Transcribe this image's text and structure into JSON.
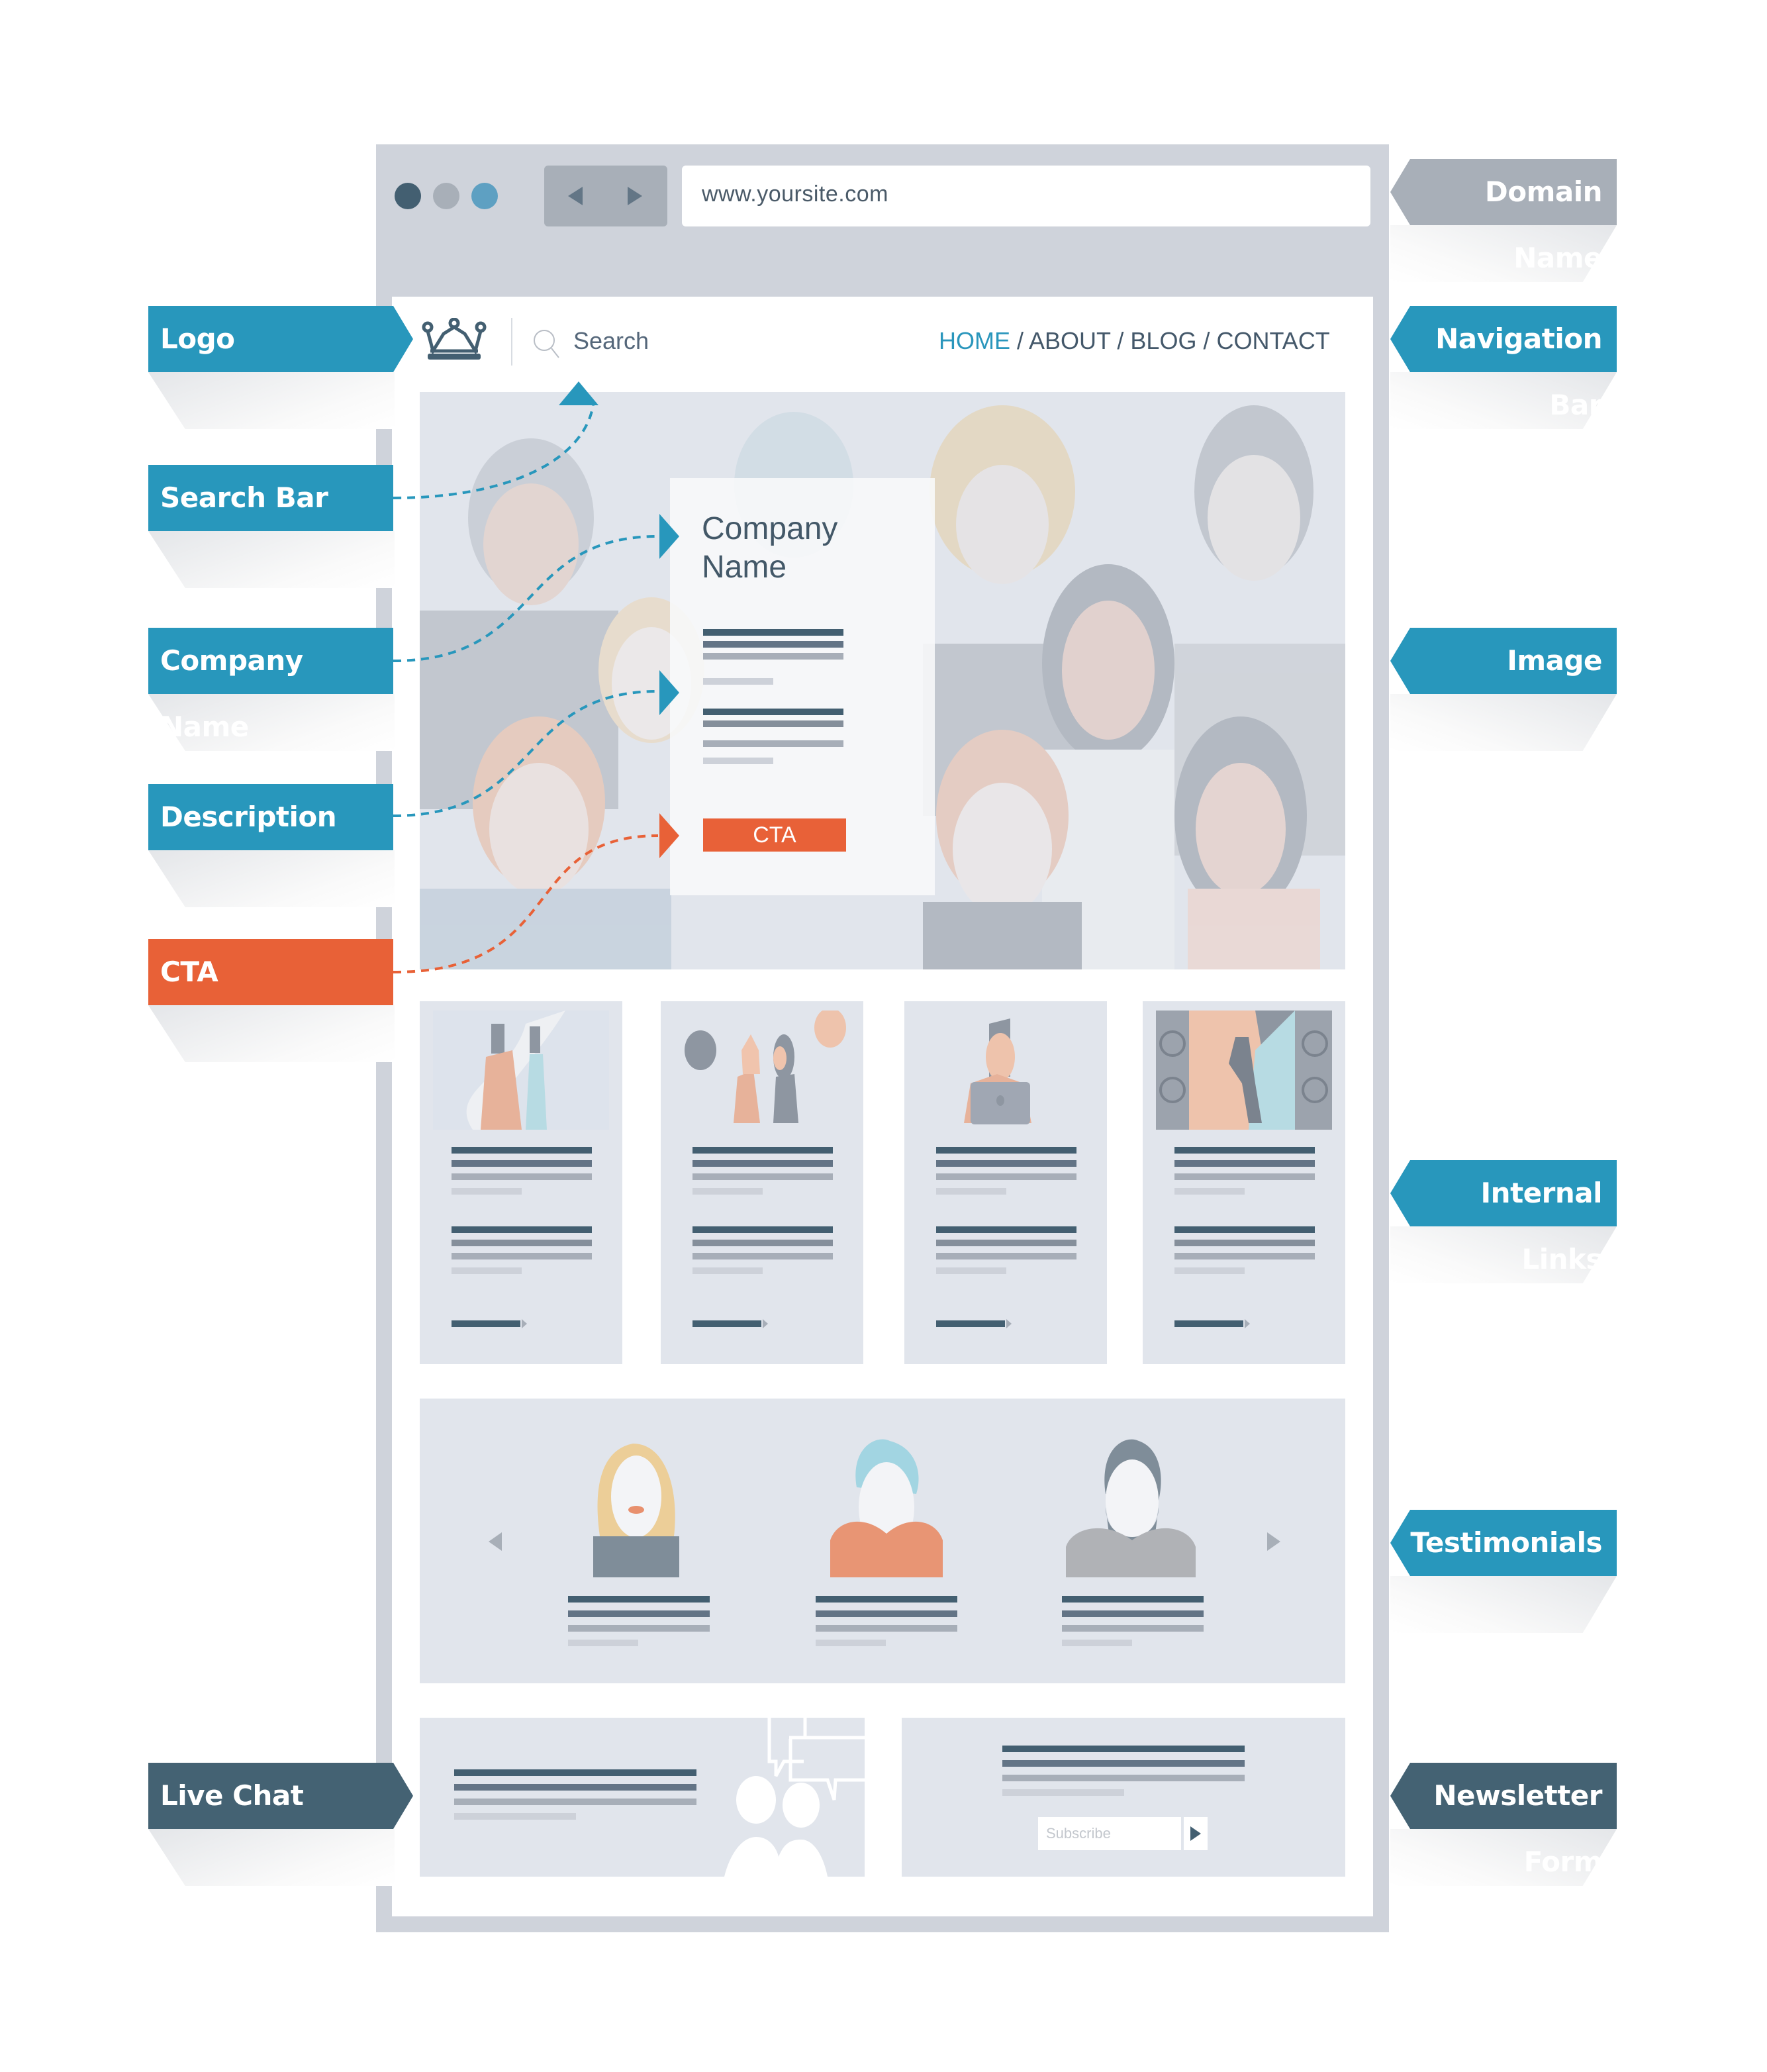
{
  "browser": {
    "window_dots": [
      {
        "name": "close",
        "color": "#435f71"
      },
      {
        "name": "minimize",
        "color": "#a8afb8"
      },
      {
        "name": "maximize",
        "color": "#5ea0c2"
      }
    ],
    "back_icon": "triangle-left",
    "forward_icon": "triangle-right",
    "url": "www.yoursite.com"
  },
  "site_header": {
    "logo_icon": "crown-icon",
    "search_placeholder": "Search",
    "nav": [
      {
        "label": "HOME",
        "active": true
      },
      {
        "label": "ABOUT",
        "active": false
      },
      {
        "label": "BLOG",
        "active": false
      },
      {
        "label": "CONTACT",
        "active": false
      }
    ],
    "nav_separator": " / "
  },
  "hero": {
    "company_name_line1": "Company",
    "company_name_line2": "Name",
    "cta_label": "CTA",
    "background": "illustrated group of people"
  },
  "internal_links": {
    "cards": [
      {
        "thumb": "couple-walking"
      },
      {
        "thumb": "people-talking-speech-bubbles"
      },
      {
        "thumb": "man-with-laptop"
      },
      {
        "thumb": "singer-with-speakers"
      }
    ]
  },
  "testimonials": {
    "prev_icon": "chevron-left",
    "next_icon": "chevron-right",
    "people": [
      {
        "avatar": "blonde-woman"
      },
      {
        "avatar": "blue-haired-man"
      },
      {
        "avatar": "bearded-man"
      }
    ]
  },
  "live_chat": {
    "icon": "chat-people-icon"
  },
  "newsletter": {
    "input_placeholder": "Subscribe",
    "submit_icon": "play-arrow"
  },
  "annotations": {
    "left": [
      {
        "label": "Logo",
        "color": "#2897bc"
      },
      {
        "label": "Search Bar",
        "color": "#2897bc"
      },
      {
        "label": "Company Name",
        "color": "#2897bc"
      },
      {
        "label": "Description",
        "color": "#2897bc"
      },
      {
        "label": "CTA",
        "color": "#e86137"
      },
      {
        "label": "Live Chat",
        "color": "#446273"
      }
    ],
    "right": [
      {
        "label": "Domain Name",
        "color": "#a8afb8"
      },
      {
        "label": "Navigation Bar",
        "color": "#2897bc"
      },
      {
        "label": "Image",
        "color": "#2897bc"
      },
      {
        "label": "Internal Links",
        "color": "#2897bc"
      },
      {
        "label": "Testimonials",
        "color": "#2897bc"
      },
      {
        "label": "Newsletter Form",
        "color": "#446273"
      }
    ]
  }
}
